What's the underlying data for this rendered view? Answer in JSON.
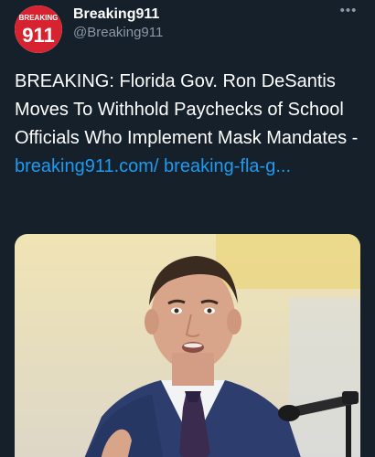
{
  "account": {
    "avatar_line1": "BREAKING",
    "avatar_line2": "911",
    "display_name": "Breaking911",
    "handle": "@Breaking911"
  },
  "tweet": {
    "text": "BREAKING: Florida Gov. Ron DeSantis Moves To Withhold Paychecks of School Officials Who Implement Mask Mandates - ",
    "link_text": "breaking911.com/ breaking-fla-g..."
  },
  "icons": {
    "more": "more-horizontal-icon"
  },
  "colors": {
    "background": "#15202b",
    "link": "#1d9bf0",
    "brand_red": "#d7232f",
    "secondary_text": "#8b98a5"
  }
}
